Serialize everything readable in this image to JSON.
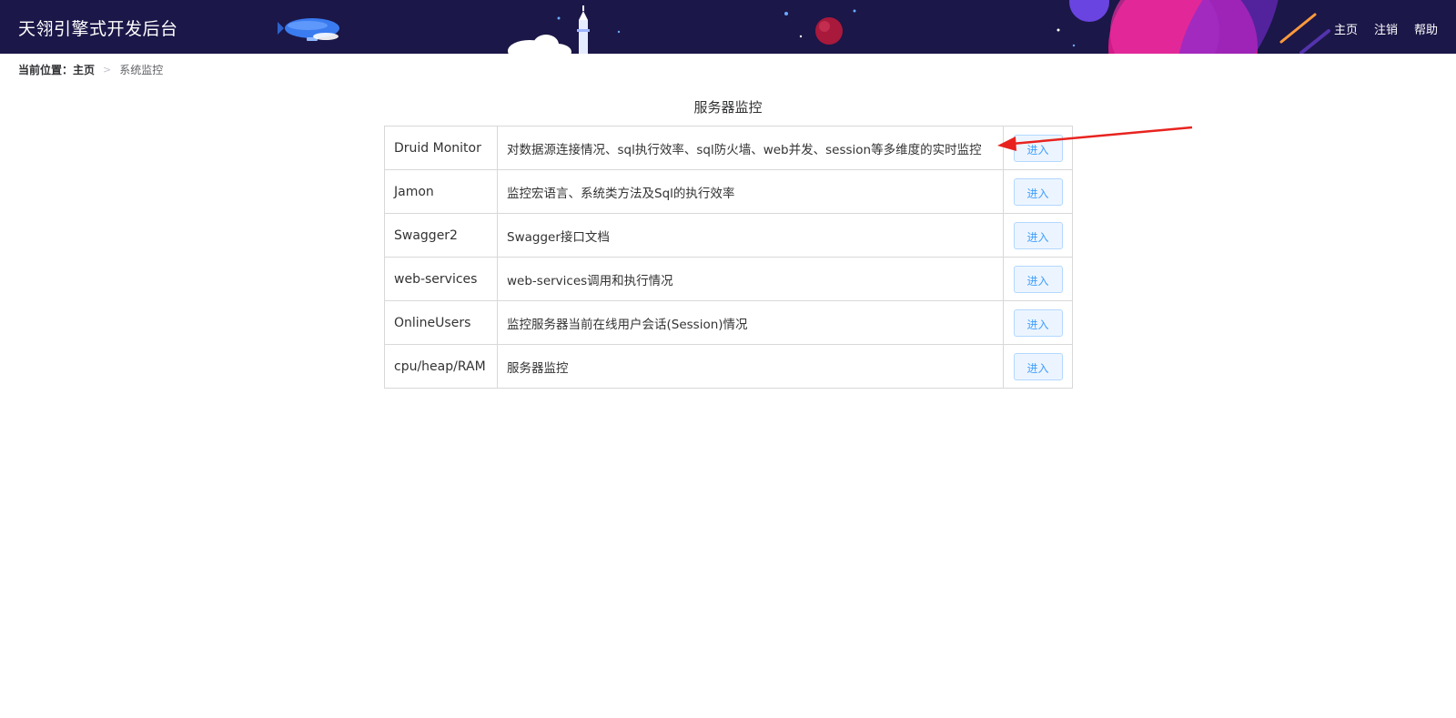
{
  "app": {
    "title": "天翎引擎式开发后台"
  },
  "nav": {
    "items": [
      {
        "label": "主页"
      },
      {
        "label": "注销"
      },
      {
        "label": "帮助"
      }
    ]
  },
  "breadcrumb": {
    "prefix": "当前位置：",
    "home": "主页",
    "separator": ">",
    "current": "系统监控"
  },
  "panel": {
    "title": "服务器监控",
    "action_label": "进入",
    "rows": [
      {
        "name": "Druid Monitor",
        "description": "对数据源连接情况、sql执行效率、sql防火墙、web并发、session等多维度的实时监控"
      },
      {
        "name": "Jamon",
        "description": "监控宏语言、系统类方法及Sql的执行效率"
      },
      {
        "name": "Swagger2",
        "description": "Swagger接口文档"
      },
      {
        "name": "web-services",
        "description": "web-services调用和执行情况"
      },
      {
        "name": "OnlineUsers",
        "description": "监控服务器当前在线用户会话(Session)情况"
      },
      {
        "name": "cpu/heap/RAM",
        "description": "服务器监控"
      }
    ]
  },
  "colors": {
    "header_bg": "#1b1748",
    "button_bg": "#ecf5ff",
    "button_border": "#b3d8ff",
    "button_text": "#409eff",
    "annotation_arrow": "#e8231f"
  }
}
